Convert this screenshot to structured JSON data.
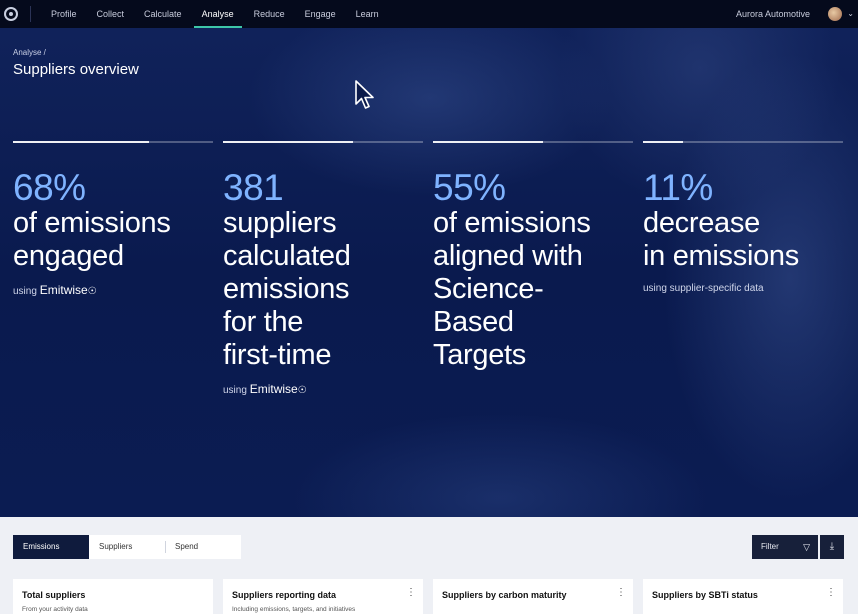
{
  "nav": {
    "items": [
      "Profile",
      "Collect",
      "Calculate",
      "Analyse",
      "Reduce",
      "Engage",
      "Learn"
    ],
    "active_index": 3,
    "org_name": "Aurora Automotive"
  },
  "hero": {
    "breadcrumb": "Analyse  /",
    "title": "Suppliers overview",
    "stats": [
      {
        "value": "68%",
        "desc": [
          "of emissions",
          "engaged"
        ],
        "note": "using",
        "brand": "Emitwise",
        "progress": 0.68
      },
      {
        "value": "381",
        "desc": [
          "suppliers",
          "calculated",
          "emissions",
          "for the",
          "first-time"
        ],
        "note": "using",
        "brand": "Emitwise",
        "progress": 0.65
      },
      {
        "value": "55%",
        "desc": [
          "of emissions",
          "aligned with",
          "Science-",
          "Based",
          "Targets"
        ],
        "note": "",
        "brand": "",
        "progress": 0.55
      },
      {
        "value": "11%",
        "desc": [
          "decrease",
          "in emissions"
        ],
        "note": "using supplier-specific data",
        "brand": "",
        "progress": 0.2
      }
    ]
  },
  "tabs": {
    "items": [
      "Emissions",
      "Suppliers",
      "Spend"
    ],
    "active_index": 0
  },
  "toolbar": {
    "filter_label": "Filter"
  },
  "cards": [
    {
      "title": "Total suppliers",
      "subtitle": "From your activity data"
    },
    {
      "title": "Suppliers reporting data",
      "subtitle": "Including emissions, targets, and initiatives"
    },
    {
      "title": "Suppliers by carbon maturity",
      "subtitle": ""
    },
    {
      "title": "Suppliers by SBTi status",
      "subtitle": ""
    }
  ],
  "icons": {
    "logo": "emitwise-logo-icon",
    "filter": "filter-icon",
    "download": "download-icon",
    "menu": "more-vertical-icon",
    "chevron": "chevron-down-icon"
  }
}
